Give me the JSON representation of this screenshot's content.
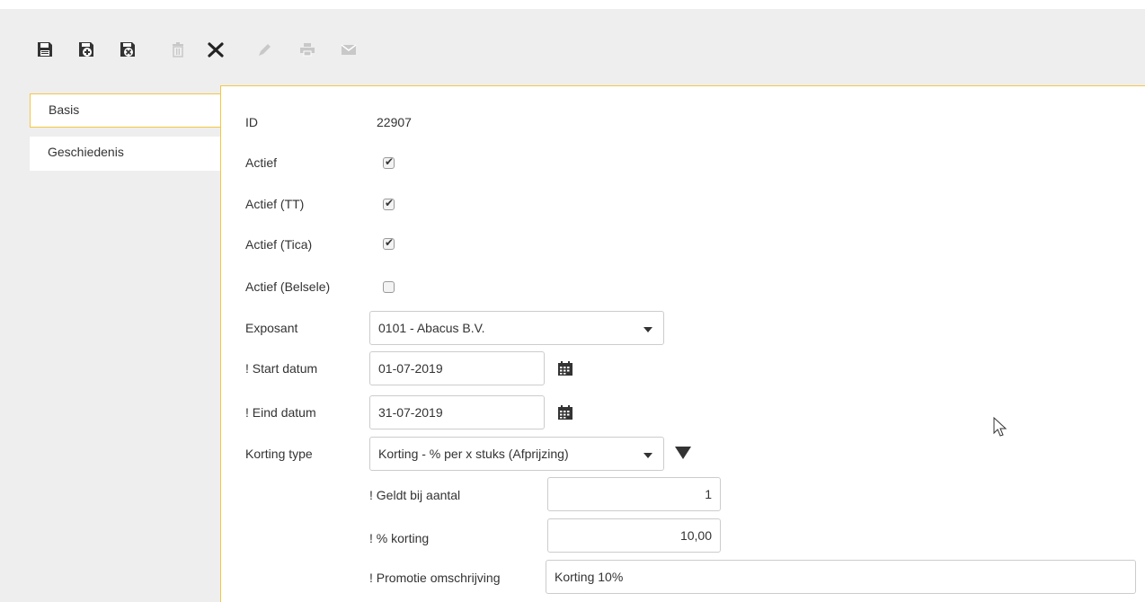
{
  "toolbar": {
    "icons": [
      "save-icon",
      "save-new-icon",
      "save-close-icon",
      "delete-icon",
      "close-icon",
      "edit-icon",
      "print-icon",
      "email-icon"
    ]
  },
  "tabs": [
    {
      "label": "Basis",
      "active": true
    },
    {
      "label": "Geschiedenis",
      "active": false
    }
  ],
  "form": {
    "id_label": "ID",
    "id_value": "22907",
    "actief_label": "Actief",
    "actief_checked": true,
    "actief_tt_label": "Actief (TT)",
    "actief_tt_checked": true,
    "actief_tica_label": "Actief (Tica)",
    "actief_tica_checked": true,
    "actief_belsele_label": "Actief (Belsele)",
    "actief_belsele_checked": false,
    "exposant_label": "Exposant",
    "exposant_value": "0101 - Abacus B.V.",
    "start_datum_label": "! Start datum",
    "start_datum_value": "01-07-2019",
    "eind_datum_label": "! Eind datum",
    "eind_datum_value": "31-07-2019",
    "korting_type_label": "Korting type",
    "korting_type_value": "Korting - % per x stuks (Afprijzing)",
    "geldt_label": "! Geldt bij aantal",
    "geldt_value": "1",
    "pct_korting_label": "! % korting",
    "pct_korting_value": "10,00",
    "promotie_label": "! Promotie omschrijving",
    "promotie_value": "Korting 10%"
  },
  "colors": {
    "accent_border": "#f3c743",
    "app_background": "#eeeeee",
    "icon_dark": "#333333",
    "icon_disabled": "#c8c8c8"
  }
}
